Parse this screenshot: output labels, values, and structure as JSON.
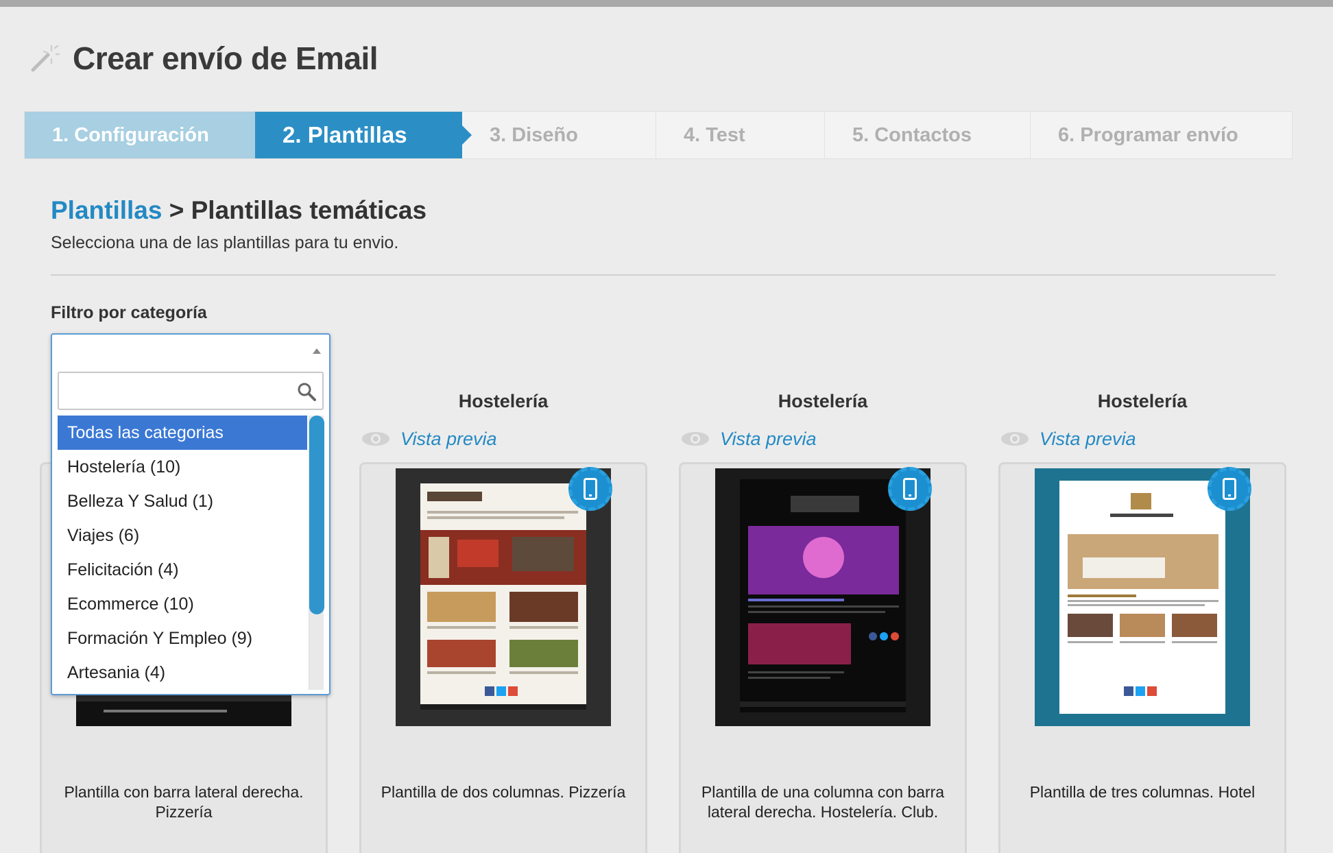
{
  "header": {
    "title": "Crear envío de Email"
  },
  "steps": [
    {
      "label": "1. Configuración",
      "state": "done"
    },
    {
      "label": "2. Plantillas",
      "state": "active"
    },
    {
      "label": "3. Diseño",
      "state": "todo"
    },
    {
      "label": "4. Test",
      "state": "todo"
    },
    {
      "label": "5. Contactos",
      "state": "todo"
    },
    {
      "label": "6. Programar envío",
      "state": "todo"
    }
  ],
  "breadcrumb": {
    "root": "Plantillas",
    "separator": " > ",
    "current": "Plantillas temáticas"
  },
  "subtitle": "Selecciona una de las plantillas para tu envio.",
  "filter": {
    "label": "Filtro por categoría",
    "search_value": "",
    "options": [
      "Todas las categorias",
      "Hostelería (10)",
      "Belleza Y Salud (1)",
      "Viajes (6)",
      "Felicitación (4)",
      "Ecommerce (10)",
      "Formación Y Empleo (9)",
      "Artesania (4)"
    ],
    "selected_index": 0
  },
  "cards": [
    {
      "category": "",
      "preview": "",
      "description": "Plantilla con barra lateral derecha. Pizzería"
    },
    {
      "category": "Hostelería",
      "preview": "Vista previa",
      "description": "Plantilla de dos columnas. Pizzería"
    },
    {
      "category": "Hostelería",
      "preview": "Vista previa",
      "description": "Plantilla de una columna con barra lateral derecha. Hostelería. Club."
    },
    {
      "category": "Hostelería",
      "preview": "Vista previa",
      "description": "Plantilla de tres columnas. Hotel"
    }
  ],
  "colors": {
    "accent": "#2b8fc5",
    "done": "#a8cfe2",
    "link": "#2389c4",
    "selected": "#3a78d4"
  },
  "icons": {
    "title": "magic-wand-icon",
    "preview": "eye-icon",
    "search": "search-icon",
    "mobile": "mobile-phone-icon"
  }
}
